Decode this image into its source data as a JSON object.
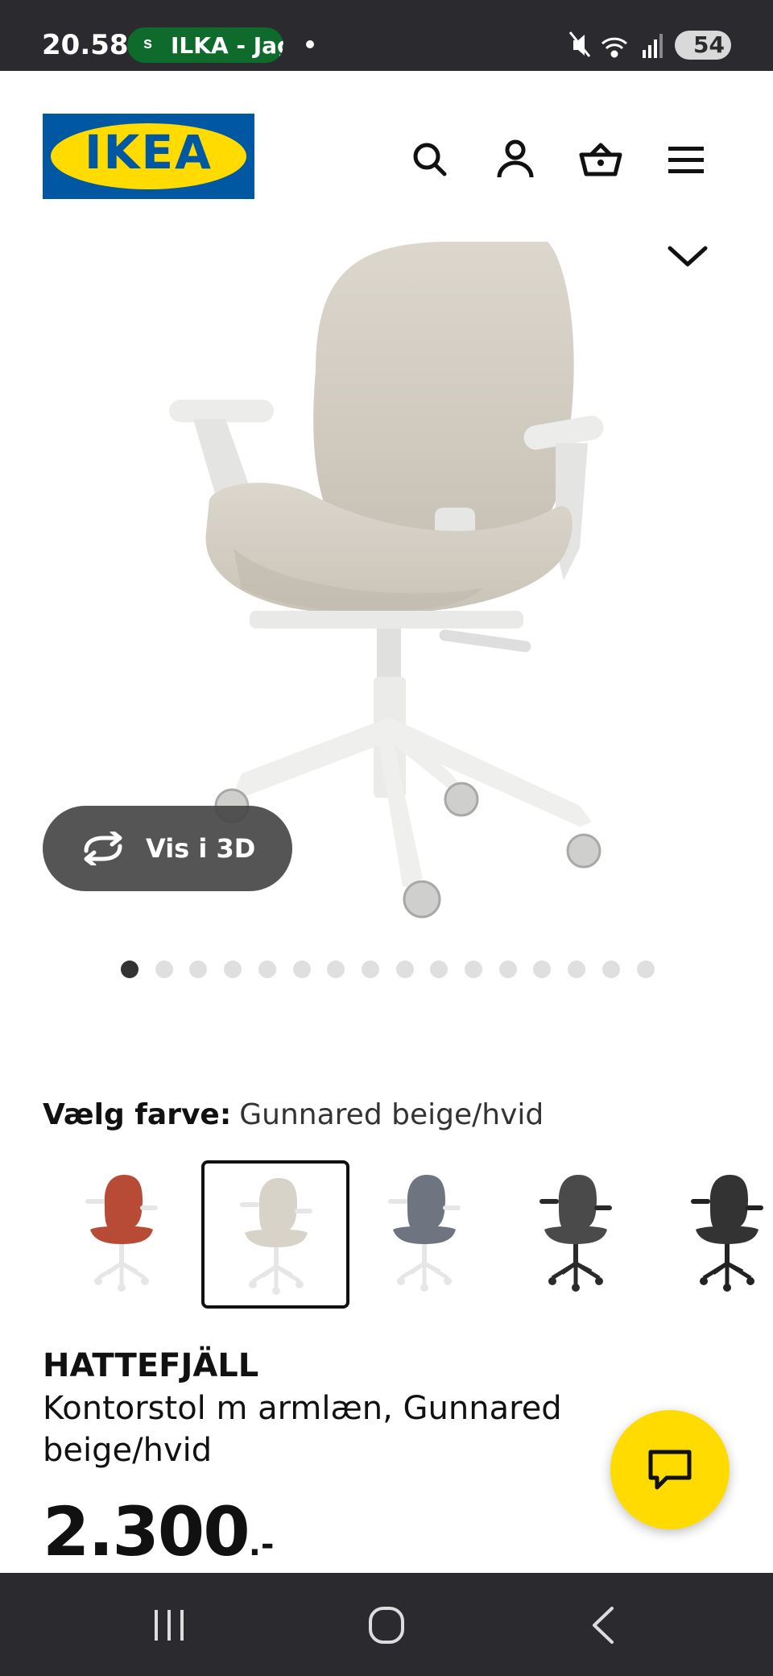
{
  "status_bar": {
    "time": "20.58",
    "pill_icon": "s",
    "pill_text": "ILKA - Jag",
    "battery": "54",
    "icons": [
      "mute-icon",
      "wifi-icon",
      "signal-icon",
      "battery-icon"
    ]
  },
  "header": {
    "logo_text": "IKEA",
    "icons": [
      "search-icon",
      "account-icon",
      "basket-icon",
      "menu-icon"
    ]
  },
  "gallery": {
    "view_3d_label": "Vis i 3D",
    "image_count": 16,
    "active_index": 0
  },
  "color_selection": {
    "label": "Vælg farve:",
    "value": "Gunnared beige/hvid",
    "swatches": [
      {
        "color": "#b84b36",
        "frame": "#e6e6e6"
      },
      {
        "color": "#d8d3c8",
        "frame": "#e6e6e6",
        "selected": true
      },
      {
        "color": "#6e7480",
        "frame": "#e6e6e6"
      },
      {
        "color": "#4a4a4a",
        "frame": "#2a2a2a"
      },
      {
        "color": "#333333",
        "frame": "#222222"
      }
    ]
  },
  "product": {
    "name": "HATTEFJÄLL",
    "description": "Kontorstol m armlæn, Gunnared beige/hvid",
    "price": "2.300",
    "price_suffix": ".-"
  },
  "colors": {
    "ikea_blue": "#0058a3",
    "ikea_yellow": "#ffdb00",
    "system_bar": "#2b2b2f"
  }
}
